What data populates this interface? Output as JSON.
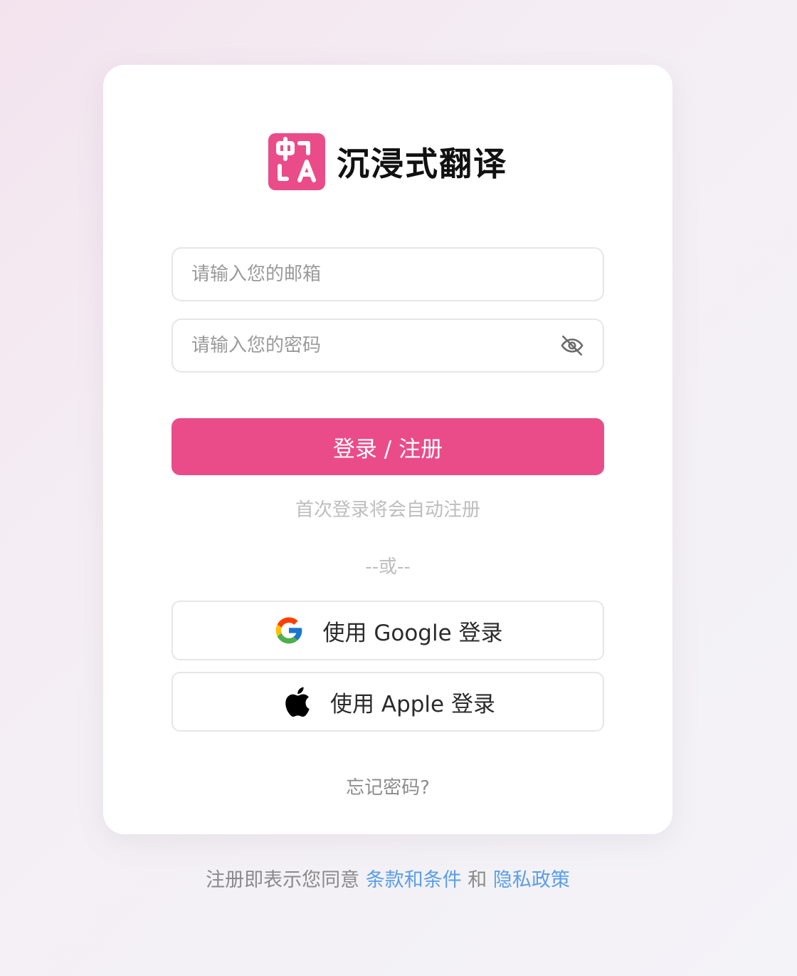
{
  "brand": {
    "name": "沉浸式翻译",
    "logo_text_top": "中",
    "logo_text_bottom": "A",
    "accent_color": "#ea4c89"
  },
  "form": {
    "email_placeholder": "请输入您的邮箱",
    "email_value": "",
    "password_placeholder": "请输入您的密码",
    "password_value": "",
    "submit_label": "登录 / 注册",
    "auto_register_hint": "首次登录将会自动注册",
    "divider": "--或--"
  },
  "oauth": {
    "google_label": "使用 Google 登录",
    "apple_label": "使用 Apple 登录"
  },
  "forgot_password": "忘记密码?",
  "footer": {
    "prefix": "注册即表示您同意",
    "terms_link": "条款和条件",
    "and": "和",
    "privacy_link": "隐私政策",
    "link_color": "#5a9ee8"
  },
  "icons": {
    "password_toggle": "eye-off-icon",
    "google": "google-icon",
    "apple": "apple-icon"
  }
}
